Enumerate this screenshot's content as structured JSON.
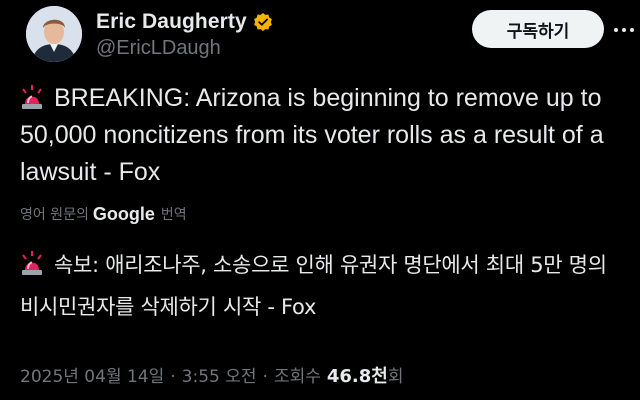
{
  "author": {
    "display_name": "Eric Daugherty",
    "handle": "@EricLDaugh",
    "verified": true,
    "verified_color": "#f4b400"
  },
  "header": {
    "subscribe_label": "구독하기"
  },
  "tweet": {
    "text": "BREAKING: Arizona is beginning to remove up to 50,000 noncitizens from its voter rolls as a result of a lawsuit - Fox",
    "translate_prefix": "영어 원문의",
    "translate_provider": "Google",
    "translate_action": "번역",
    "translated_text": "속보: 애리조나주, 소송으로 인해 유권자 명단에서 최대 5만 명의 비시민권자를 삭제하기 시작 - Fox"
  },
  "meta": {
    "date": "2025년 04월 14일",
    "time": "3:55 오전",
    "views_label_prefix": "조회수",
    "views_count": "46.8천",
    "views_suffix": "회"
  },
  "colors": {
    "background": "#000000",
    "text_primary": "#e7e9ea",
    "text_secondary": "#71767b",
    "siren_red": "#e0245e"
  },
  "icons": {
    "siren": "police-car-light-icon",
    "verified": "verified-badge-icon",
    "more": "more-horizontal-icon"
  }
}
